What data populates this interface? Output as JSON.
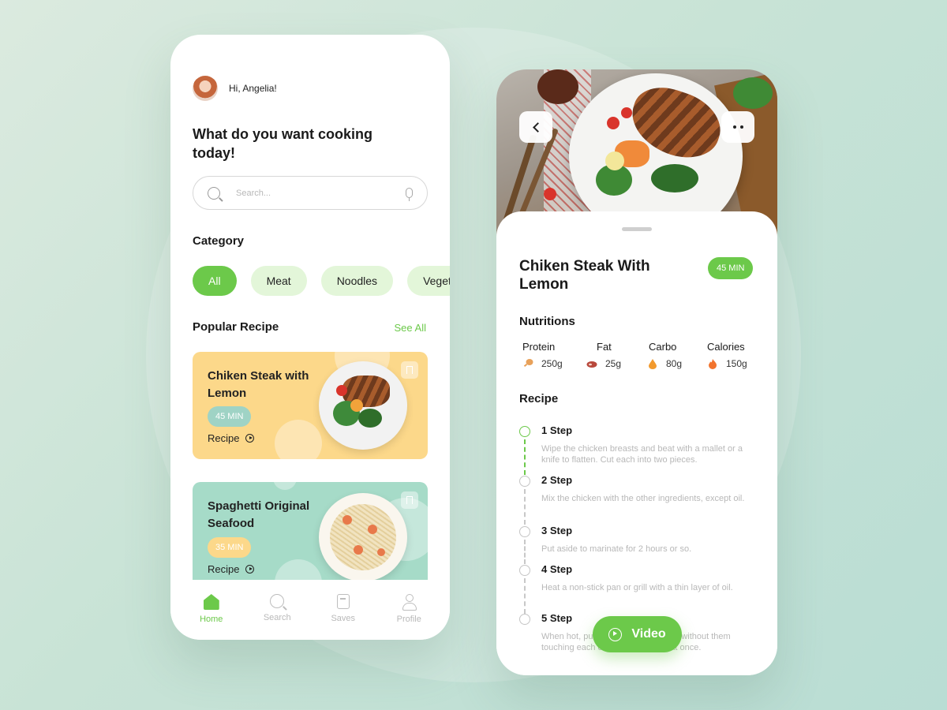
{
  "colors": {
    "accent": "#6cc94a",
    "chip_bg": "#e3f6d9",
    "card_yellow": "#fcd88a",
    "card_teal": "#a6dbc8"
  },
  "home": {
    "greeting": "Hi, Angelia!",
    "headline": "What do you want cooking today!",
    "search": {
      "placeholder": "Search..."
    },
    "category_title": "Category",
    "categories": [
      "All",
      "Meat",
      "Noodles",
      "Veget"
    ],
    "popular_title": "Popular Recipe",
    "see_all": "See All",
    "recipes": [
      {
        "title": "Chiken Steak with Lemon",
        "time": "45 MIN",
        "link": "Recipe",
        "icon": "bookmark-icon"
      },
      {
        "title": "Spaghetti Original Seafood",
        "time": "35 MIN",
        "link": "Recipe",
        "icon": "bookmark-icon"
      }
    ],
    "tabs": [
      {
        "label": "Home",
        "icon": "home-icon"
      },
      {
        "label": "Search",
        "icon": "search-icon"
      },
      {
        "label": "Saves",
        "icon": "bookmark-icon"
      },
      {
        "label": "Profile",
        "icon": "profile-icon"
      }
    ]
  },
  "detail": {
    "title": "Chiken Steak With Lemon",
    "time": "45 MIN",
    "nutritions_title": "Nutritions",
    "nutritions": [
      {
        "label": "Protein",
        "value": "250g",
        "icon": "drumstick-icon"
      },
      {
        "label": "Fat",
        "value": "25g",
        "icon": "meat-icon"
      },
      {
        "label": "Carbo",
        "value": "80g",
        "icon": "drop-icon"
      },
      {
        "label": "Calories",
        "value": "150g",
        "icon": "fire-icon"
      }
    ],
    "recipe_title": "Recipe",
    "steps": [
      {
        "name": "1 Step",
        "desc": "Wipe the chicken breasts and beat with a mallet or a knife to flatten. Cut each into two pieces."
      },
      {
        "name": "2 Step",
        "desc": "Mix the chicken with the other ingredients, except oil."
      },
      {
        "name": "3 Step",
        "desc": "Put aside to marinate for 2 hours or so."
      },
      {
        "name": "4 Step",
        "desc": "Heat a non-stick pan or grill with a thin layer of oil."
      },
      {
        "name": "5 Step",
        "desc": "When hot, put the pieces of chicken without them touching each other, turning over at once."
      }
    ],
    "video_label": "Video"
  }
}
